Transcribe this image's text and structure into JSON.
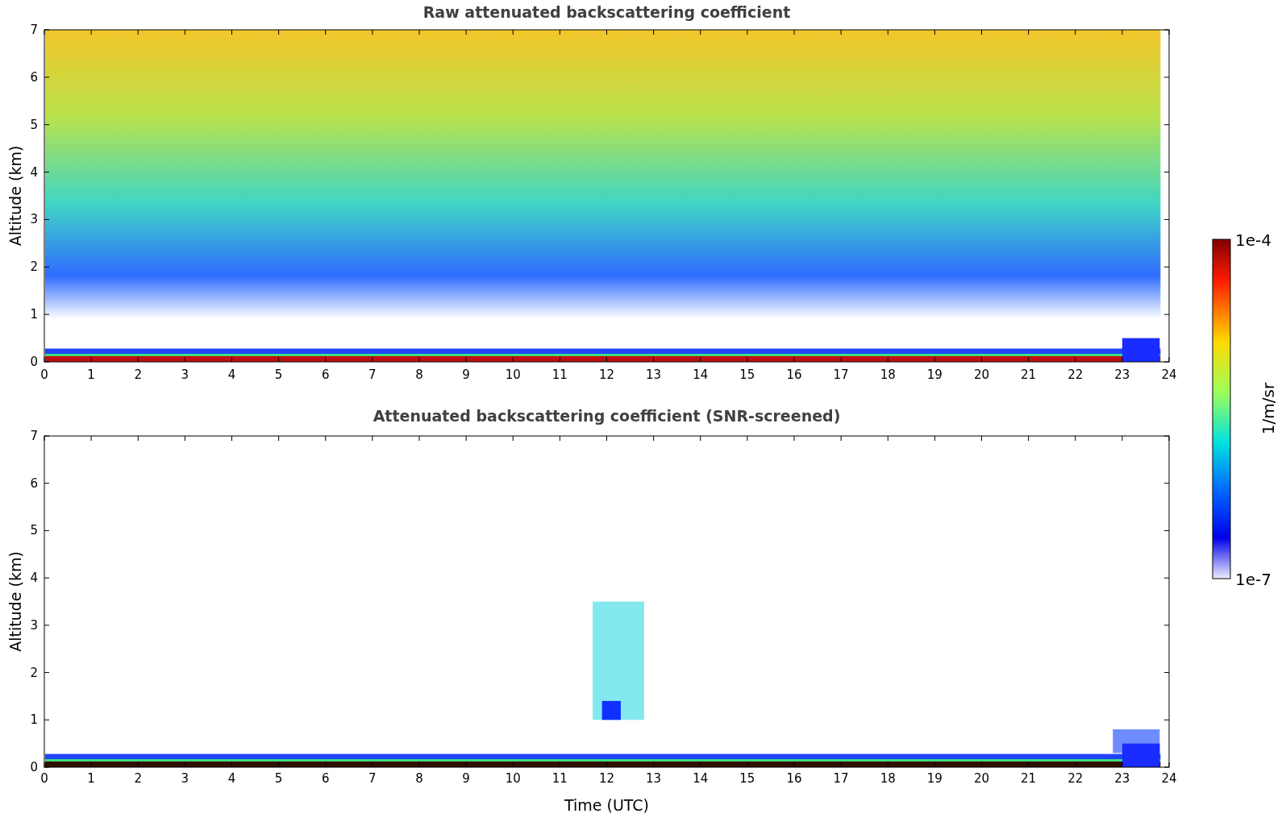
{
  "figure": {
    "panels": [
      {
        "kind": "raw",
        "title": "Raw attenuated backscattering coefficient",
        "ylabel": "Altitude (km)",
        "yticks": [
          "7",
          "6",
          "5",
          "4",
          "3",
          "2",
          "1",
          "0"
        ],
        "xticks": [
          "0",
          "1",
          "2",
          "3",
          "4",
          "5",
          "6",
          "7",
          "8",
          "9",
          "10",
          "11",
          "12",
          "13",
          "14",
          "15",
          "16",
          "17",
          "18",
          "19",
          "20",
          "21",
          "22",
          "23",
          "24"
        ]
      },
      {
        "kind": "screened",
        "title": "Attenuated backscattering coefficient (SNR-screened)",
        "ylabel": "Altitude (km)",
        "xlabel": "Time (UTC)",
        "yticks": [
          "7",
          "6",
          "5",
          "4",
          "3",
          "2",
          "1",
          "0"
        ],
        "xticks": [
          "0",
          "1",
          "2",
          "3",
          "4",
          "5",
          "6",
          "7",
          "8",
          "9",
          "10",
          "11",
          "12",
          "13",
          "14",
          "15",
          "16",
          "17",
          "18",
          "19",
          "20",
          "21",
          "22",
          "23",
          "24"
        ]
      }
    ],
    "colorbar": {
      "label": "1/m/sr",
      "max_label": "1e-4",
      "min_label": "1e-7"
    }
  }
}
